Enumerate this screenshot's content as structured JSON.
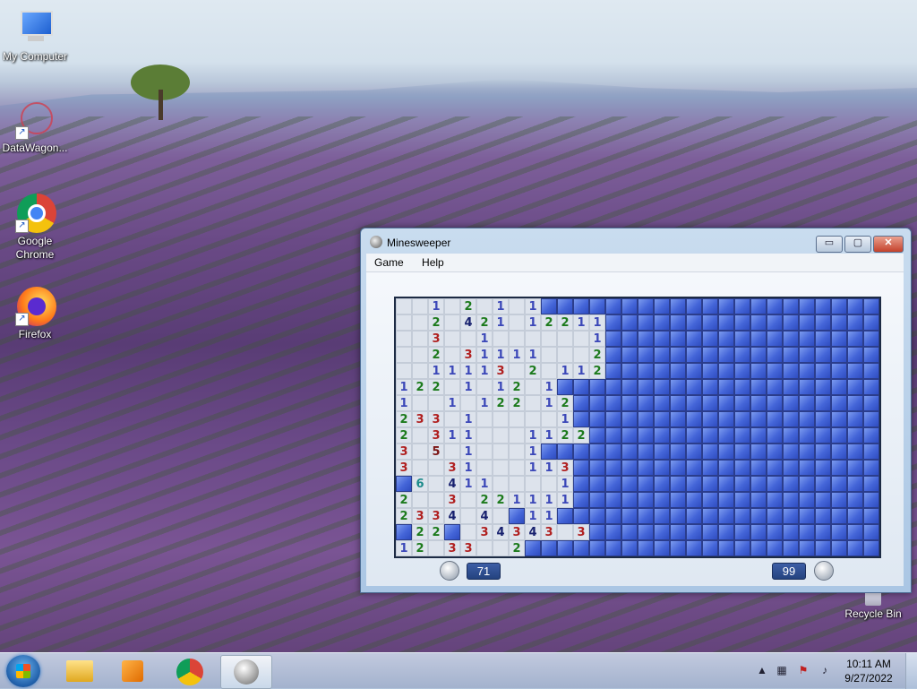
{
  "desktop": {
    "icons": [
      {
        "label": "My Computer"
      },
      {
        "label": "DataWagon..."
      },
      {
        "label": "Google Chrome"
      },
      {
        "label": "Firefox"
      },
      {
        "label": "Recycle Bin"
      }
    ]
  },
  "window": {
    "title": "Minesweeper",
    "controls": {
      "minimize": "▭",
      "maximize": "▢",
      "close": "✕"
    },
    "menu": [
      "Game",
      "Help"
    ],
    "time": "71",
    "mines": "99",
    "board": [
      "  1 2 1 1HHHHHHHHHHHHHHHHHHHHH",
      "  2 421 12211HHHHHHHHHHHHHHHHH",
      "  3  1      1HHHHHHHHHHHHHHHHH",
      "  2 31111   2HHHHHHHHHHHHHHHHH",
      "  11113 2 112HHHHHHHHHHHHHHHHH",
      "122 1 12 1HHHHHHHHHHHHHHHHHHHH",
      "1  1 122 12HHHHHHHHHHHHHHHHHHH",
      "233 1     1HHHHHHHHHHHHHHHHHHH",
      "2 311   1122HHHHHHHHHHHHHHHHHH",
      "3 5 1   1HHHHHHHHHHHHHHHHHHHHH",
      "3  31   113HHHHHHHHHHHHHHHHHHH",
      "H6 411    1HHHHHHHHHHHHHHHHHHH",
      "2  3 221111HHHHHHHHHHHHHHHHHHH",
      "2334 4 H11HHHHHHHHHHHHHHHHHHHH",
      "H22H 34343 3HHHHHHHHHHHHHHHHHH",
      "12 33  2HHHHHHHHHHHHHHHHHHHHHH"
    ]
  },
  "taskbar": {
    "items": [
      "Start",
      "Windows Explorer",
      "Media Player",
      "Google Chrome",
      "Minesweeper"
    ],
    "clock_time": "10:11 AM",
    "clock_date": "9/27/2022"
  }
}
